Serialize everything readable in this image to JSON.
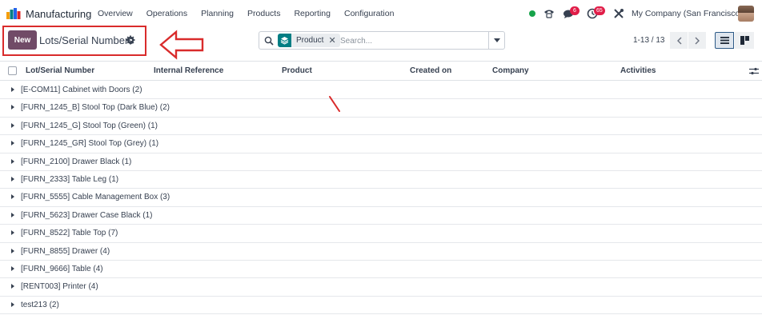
{
  "navbar": {
    "app_name": "Manufacturing",
    "menu": [
      "Overview",
      "Operations",
      "Planning",
      "Products",
      "Reporting",
      "Configuration"
    ],
    "chat_badge": "6",
    "activity_badge": "65",
    "company": "My Company (San Francisco)"
  },
  "control": {
    "new_label": "New",
    "title": "Lots/Serial Numbers",
    "search": {
      "facet_label": "Product",
      "placeholder": "Search..."
    },
    "pager": "1-13 / 13"
  },
  "table": {
    "columns": [
      "Lot/Serial Number",
      "Internal Reference",
      "Product",
      "Created on",
      "Company",
      "Activities"
    ],
    "groups": [
      "[E-COM11] Cabinet with Doors (2)",
      "[FURN_1245_B] Stool Top (Dark Blue) (2)",
      "[FURN_1245_G] Stool Top (Green) (1)",
      "[FURN_1245_GR] Stool Top (Grey) (1)",
      "[FURN_2100] Drawer Black (1)",
      "[FURN_2333] Table Leg (1)",
      "[FURN_5555] Cable Management Box (3)",
      "[FURN_5623] Drawer Case Black (1)",
      "[FURN_8522] Table Top (7)",
      "[FURN_8855] Drawer (4)",
      "[FURN_9666] Table (4)",
      "[RENT003] Printer (4)",
      "test213 (2)"
    ]
  },
  "colors": {
    "brand": "#714b67",
    "annotation_red": "#d92b2b",
    "facet_teal": "#017e84",
    "status_green": "#16a34a",
    "badge_red": "#e11d48"
  },
  "icons": [
    "search-icon",
    "gear-icon",
    "chevron-left-icon",
    "chevron-right-icon",
    "list-view-icon",
    "kanban-view-icon",
    "phone-icon",
    "chat-icon",
    "clock-icon",
    "tools-icon",
    "optional-columns-icon"
  ]
}
